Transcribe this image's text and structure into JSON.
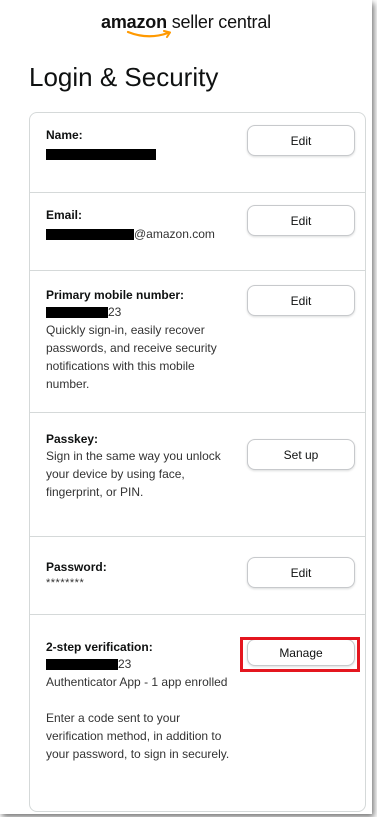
{
  "header": {
    "logo_brand": "amazon",
    "logo_suffix": "seller central"
  },
  "page": {
    "title": "Login & Security"
  },
  "sections": {
    "name": {
      "label": "Name:",
      "button": "Edit"
    },
    "email": {
      "label": "Email:",
      "value_suffix": "@amazon.com",
      "button": "Edit"
    },
    "mobile": {
      "label": "Primary mobile number:",
      "value_suffix": "23",
      "description": "Quickly sign-in, easily recover passwords, and receive security notifications with this mobile number.",
      "button": "Edit"
    },
    "passkey": {
      "label": "Passkey:",
      "description": "Sign in the same way you unlock your device by using face, fingerprint, or PIN.",
      "button": "Set up"
    },
    "password": {
      "label": "Password:",
      "value": "********",
      "button": "Edit"
    },
    "two_step": {
      "label": "2-step verification:",
      "value_suffix": "23",
      "method": "Authenticator App - 1 app enrolled",
      "description": "Enter a code sent to your verification method, in addition to your password, to sign in securely.",
      "button": "Manage"
    }
  },
  "colors": {
    "highlight": "#e4161f",
    "border": "#d5d9d9",
    "logo_smile": "#ff9900"
  },
  "icons": {
    "logo_smile": "amazon-smile-arrow"
  }
}
